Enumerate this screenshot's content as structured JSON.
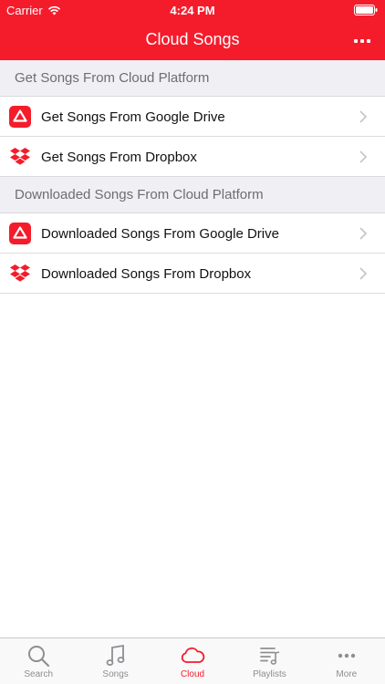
{
  "status": {
    "carrier": "Carrier",
    "time": "4:24 PM"
  },
  "nav": {
    "title": "Cloud Songs",
    "menu_icon": "ellipsis-icon"
  },
  "sections": [
    {
      "header": "Get Songs From Cloud Platform",
      "rows": [
        {
          "label": "Get Songs From Google Drive",
          "icon": "google-drive-icon"
        },
        {
          "label": "Get Songs From Dropbox",
          "icon": "dropbox-icon"
        }
      ]
    },
    {
      "header": "Downloaded Songs From Cloud Platform",
      "rows": [
        {
          "label": "Downloaded Songs From Google Drive",
          "icon": "google-drive-icon"
        },
        {
          "label": "Downloaded Songs From Dropbox",
          "icon": "dropbox-icon"
        }
      ]
    }
  ],
  "tabs": [
    {
      "label": "Search",
      "icon": "search-icon",
      "active": false
    },
    {
      "label": "Songs",
      "icon": "music-note-icon",
      "active": false
    },
    {
      "label": "Cloud",
      "icon": "cloud-icon",
      "active": true
    },
    {
      "label": "Playlists",
      "icon": "playlist-icon",
      "active": false
    },
    {
      "label": "More",
      "icon": "ellipsis-icon",
      "active": false
    }
  ],
  "colors": {
    "accent": "#f41c2b",
    "section_bg": "#efeff4",
    "inactive_tab": "#8e8e93"
  }
}
